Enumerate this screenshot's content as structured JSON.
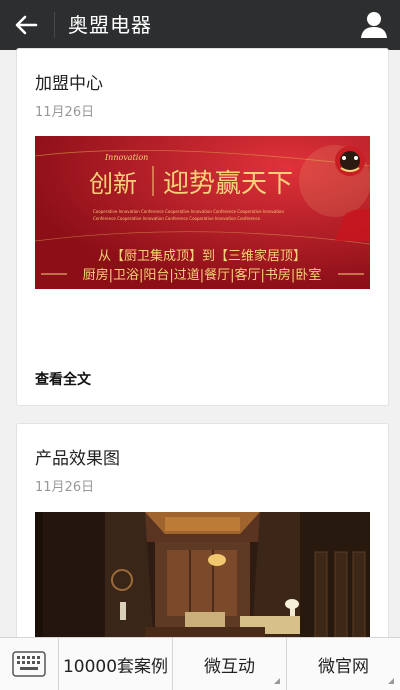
{
  "header": {
    "title": "奥盟电器",
    "back_icon": "back-arrow-icon",
    "user_icon": "user-icon"
  },
  "posts": [
    {
      "title": "加盟中心",
      "date": "11月26日",
      "banner": {
        "script_word": "Innovation",
        "headline_left": "创新",
        "headline_right": "迎势赢天下",
        "fine_line_1": "Cooperative Innovation Conference Cooperative Innovation Conference Cooperative Innovation",
        "fine_line_2": "Conference Cooperative Innovation Conference Cooperative Innovation Conference",
        "slogan": "从【厨卫集成顶】到【三维家居顶】",
        "rooms": "厨房|卫浴|阳台|过道|餐厅|客厅|书房|卧室",
        "colors": {
          "bg": "#b01622",
          "gold": "#f7d27a"
        }
      },
      "read_more": "查看全文"
    },
    {
      "title": "产品效果图",
      "date": "11月26日"
    }
  ],
  "bottom_menu": {
    "keyboard_icon": "keyboard-icon",
    "items": [
      {
        "label": "10000套案例"
      },
      {
        "label": "微互动"
      },
      {
        "label": "微官网"
      }
    ]
  }
}
